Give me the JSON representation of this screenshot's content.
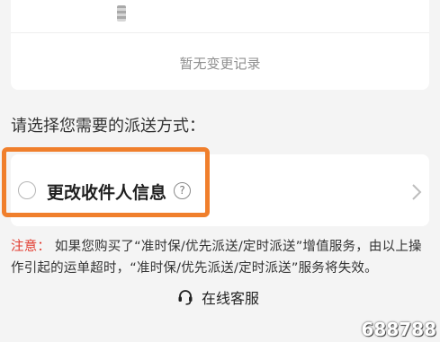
{
  "record": {
    "empty_text": "暂无变更记录"
  },
  "delivery": {
    "prompt": "请选择您需要的派送方式：",
    "option_label": "更改收件人信息",
    "help_glyph": "?"
  },
  "notice": {
    "key": "注意：",
    "text": "如果您购买了“准时保/优先派送/定时派送”增值服务，由以上操作引起的运单超时，“准时保/优先派送/定时派送”服务将失效。"
  },
  "service": {
    "label": "在线客服",
    "icon": "headset-icon"
  },
  "watermark": "688788",
  "colors": {
    "highlight": "#f07f2c",
    "notice_key": "#e23a2e"
  }
}
